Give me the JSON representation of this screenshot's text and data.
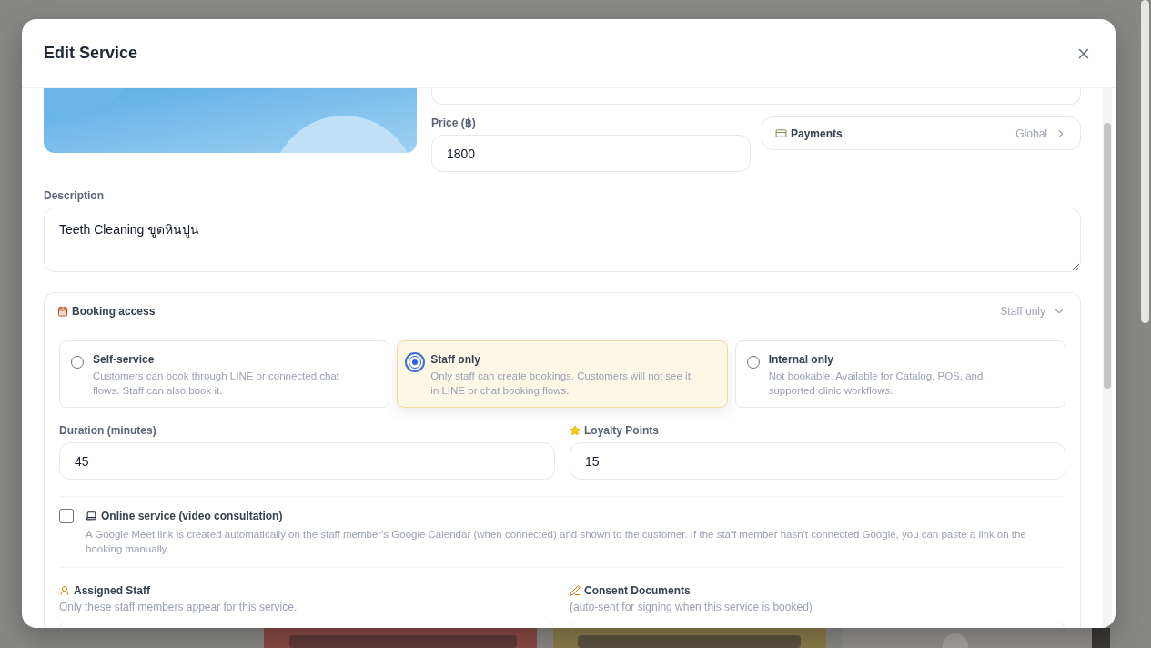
{
  "dialog": {
    "title": "Edit Service"
  },
  "price": {
    "label": "Price (฿)",
    "value": "1800"
  },
  "payments": {
    "label": "Payments",
    "value": "Global"
  },
  "description": {
    "label": "Description",
    "value": "Teeth Cleaning ขูดหินปูน"
  },
  "booking_access": {
    "title": "Booking access",
    "summary": "Staff only",
    "expanded": true,
    "options": [
      {
        "title": "Self-service",
        "description": "Customers can book through LINE or connected chat flows. Staff can also book it.",
        "selected": false
      },
      {
        "title": "Staff only",
        "description": "Only staff can create bookings. Customers will not see it in LINE or chat booking flows.",
        "selected": true
      },
      {
        "title": "Internal only",
        "description": "Not bookable. Available for Catalog, POS, and supported clinic workflows.",
        "selected": false
      }
    ]
  },
  "duration": {
    "label": "Duration (minutes)",
    "value": "45"
  },
  "loyalty_points": {
    "label": "Loyalty Points",
    "value": "15"
  },
  "online_service": {
    "label": "Online service (video consultation)",
    "checked": false,
    "description": "A Google Meet link is created automatically on the staff member's Google Calendar (when connected) and shown to the customer. If the staff member hasn't connected Google, you can paste a link on the booking manually."
  },
  "assigned_staff": {
    "title": "Assigned Staff",
    "subtitle": "Only these staff members appear for this service."
  },
  "consent_documents": {
    "title": "Consent Documents",
    "subtitle": "(auto-sent for signing when this service is booked)"
  }
}
